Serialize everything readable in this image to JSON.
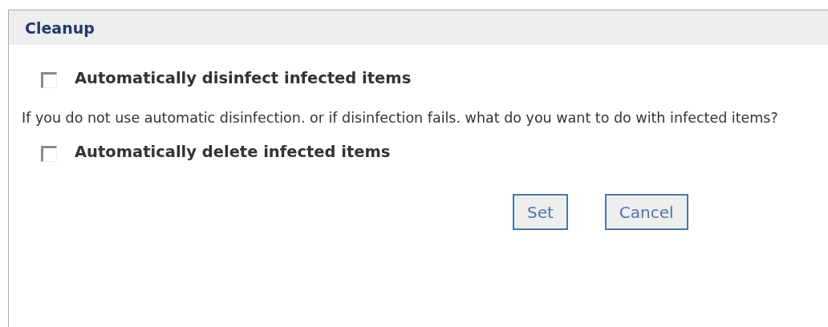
{
  "panel": {
    "title": "Cleanup"
  },
  "options": [
    {
      "label": "Automatically disinfect infected items",
      "checked": false
    }
  ],
  "description": "If you do not use automatic disinfection. or if disinfection fails. what do you want to do with infected items?",
  "options_after": [
    {
      "label": "Automatically delete infected items",
      "checked": false
    }
  ],
  "buttons": [
    {
      "label": "Set"
    },
    {
      "label": "Cancel"
    }
  ]
}
